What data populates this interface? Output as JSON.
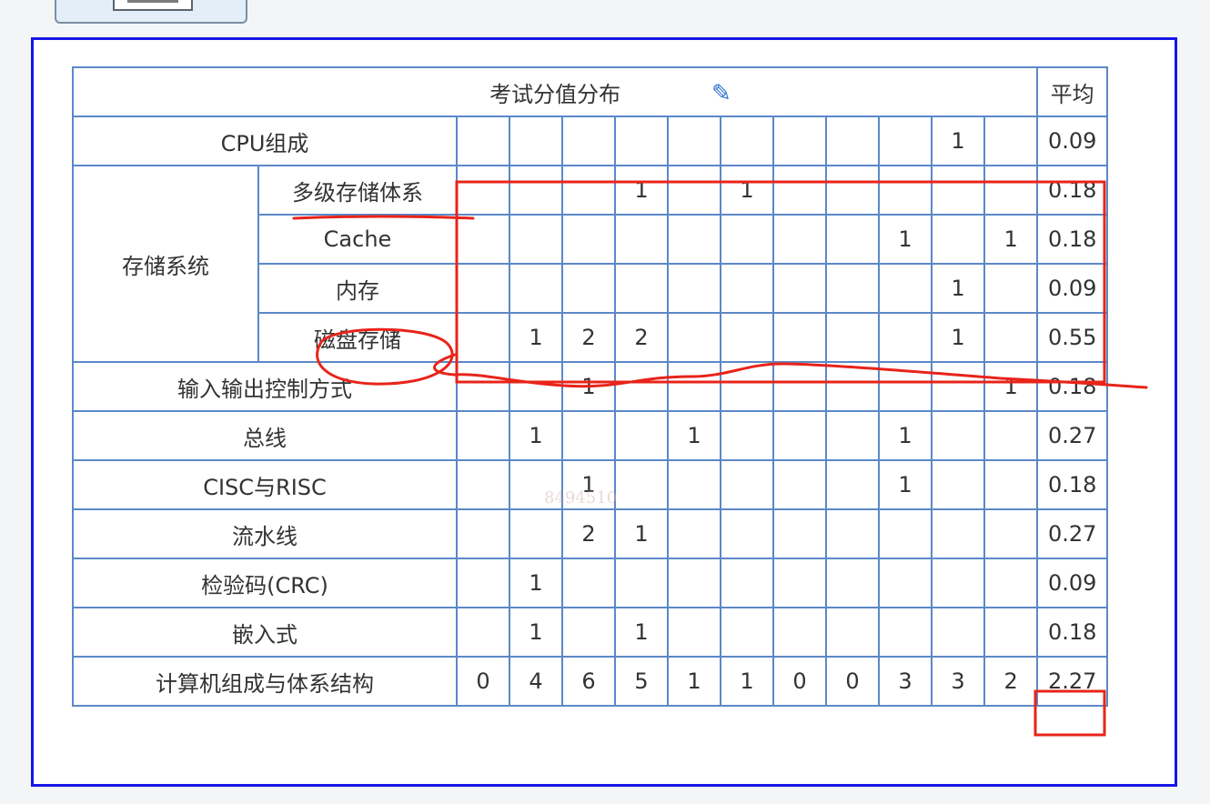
{
  "table": {
    "title": "考试分值分布",
    "avg_header": "平均",
    "group_storage": "存储系统",
    "rows": [
      {
        "label": "CPU组成",
        "cells": [
          "",
          "",
          "",
          "",
          "",
          "",
          "",
          "",
          "",
          "1",
          ""
        ],
        "avg": "0.09"
      },
      {
        "label": "多级存储体系",
        "cells": [
          "",
          "",
          "",
          "1",
          "",
          "1",
          "",
          "",
          "",
          "",
          ""
        ],
        "avg": "0.18"
      },
      {
        "label": "Cache",
        "cells": [
          "",
          "",
          "",
          "",
          "",
          "",
          "",
          "",
          "1",
          "",
          "1"
        ],
        "avg": "0.18"
      },
      {
        "label": "内存",
        "cells": [
          "",
          "",
          "",
          "",
          "",
          "",
          "",
          "",
          "",
          "1",
          ""
        ],
        "avg": "0.09"
      },
      {
        "label": "磁盘存储",
        "cells": [
          "",
          "1",
          "2",
          "2",
          "",
          "",
          "",
          "",
          "",
          "1",
          ""
        ],
        "avg": "0.55"
      },
      {
        "label": "输入输出控制方式",
        "cells": [
          "",
          "",
          "1",
          "",
          "",
          "",
          "",
          "",
          "",
          "",
          "1"
        ],
        "avg": "0.18"
      },
      {
        "label": "总线",
        "cells": [
          "",
          "1",
          "",
          "",
          "1",
          "",
          "",
          "",
          "1",
          "",
          ""
        ],
        "avg": "0.27"
      },
      {
        "label": "CISC与RISC",
        "cells": [
          "",
          "",
          "1",
          "",
          "",
          "",
          "",
          "",
          "1",
          "",
          ""
        ],
        "avg": "0.18"
      },
      {
        "label": "流水线",
        "cells": [
          "",
          "",
          "2",
          "1",
          "",
          "",
          "",
          "",
          "",
          "",
          ""
        ],
        "avg": "0.27"
      },
      {
        "label": "检验码(CRC)",
        "cells": [
          "",
          "1",
          "",
          "",
          "",
          "",
          "",
          "",
          "",
          "",
          ""
        ],
        "avg": "0.09"
      },
      {
        "label": "嵌入式",
        "cells": [
          "",
          "1",
          "",
          "1",
          "",
          "",
          "",
          "",
          "",
          "",
          ""
        ],
        "avg": "0.18"
      },
      {
        "label": "计算机组成与体系结构",
        "cells": [
          "0",
          "4",
          "6",
          "5",
          "1",
          "1",
          "0",
          "0",
          "3",
          "3",
          "2"
        ],
        "avg": "2.27"
      }
    ]
  },
  "watermark": "8494510",
  "colors": {
    "frame": "#1515e8",
    "grid": "#5b88c7",
    "annotation": "#e8241a"
  },
  "icons": {
    "pencil": "pencil-icon",
    "toolbar": "document-icon"
  }
}
